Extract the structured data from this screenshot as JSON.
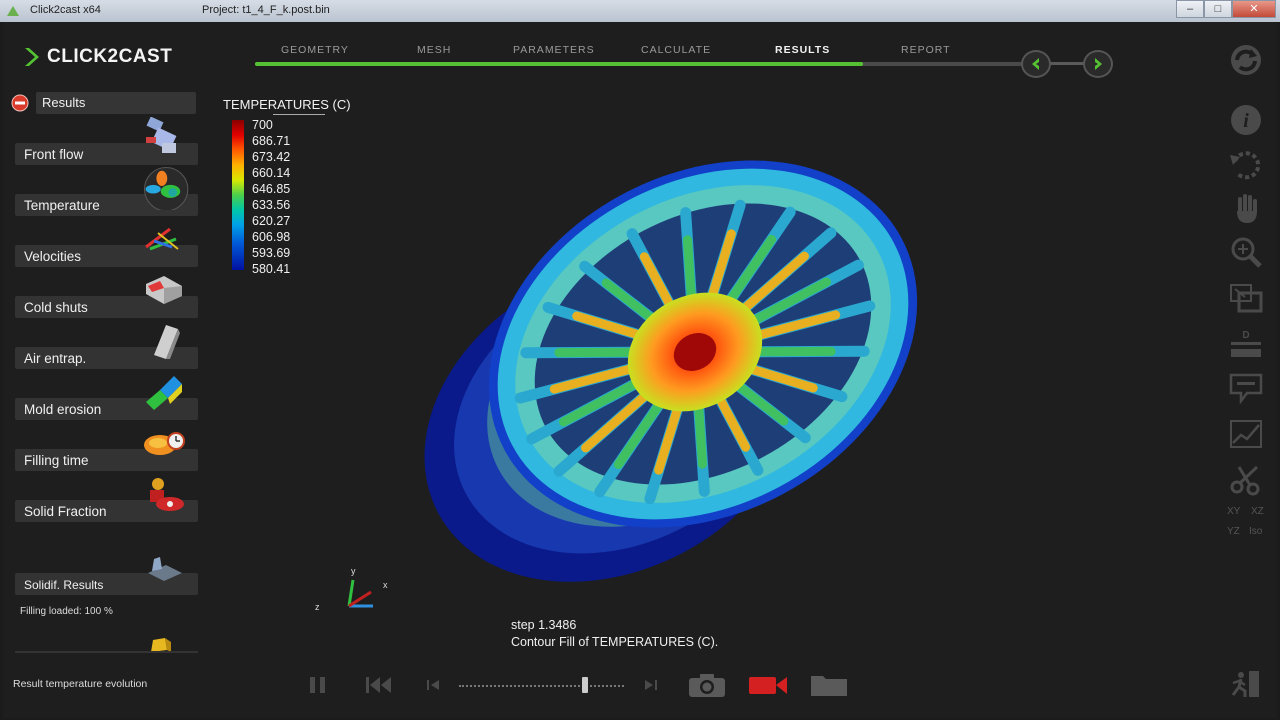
{
  "os": {
    "app_title": "Click2cast x64",
    "project_title": "Project: t1_4_F_k.post.bin"
  },
  "logo": {
    "text": "CLICK2CAST"
  },
  "workflow": {
    "tabs": [
      {
        "label": "GEOMETRY"
      },
      {
        "label": "MESH"
      },
      {
        "label": "PARAMETERS"
      },
      {
        "label": "CALCULATE"
      },
      {
        "label": "RESULTS"
      },
      {
        "label": "REPORT"
      }
    ],
    "active": "RESULTS",
    "progress_fraction": 0.78
  },
  "sidebar": {
    "header": "Results",
    "items": [
      {
        "label": "Front flow",
        "icon": "front-flow-icon"
      },
      {
        "label": "Temperature",
        "icon": "temperature-icon"
      },
      {
        "label": "Velocities",
        "icon": "velocities-icon"
      },
      {
        "label": "Cold shuts",
        "icon": "cold-shuts-icon"
      },
      {
        "label": "Air entrap.",
        "icon": "air-entrapment-icon"
      },
      {
        "label": "Mold erosion",
        "icon": "mold-erosion-icon"
      },
      {
        "label": "Filling time",
        "icon": "filling-time-icon"
      },
      {
        "label": "Solid Fraction",
        "icon": "solid-fraction-icon"
      },
      {
        "label": "Solidif. Results",
        "icon": "solidification-results-icon"
      }
    ],
    "filling_loaded": "Filling loaded: 100 %",
    "status": "Result temperature evolution"
  },
  "legend": {
    "title": "TEMPERATURES (C)",
    "values": [
      "700",
      "686.71",
      "673.42",
      "660.14",
      "646.85",
      "633.56",
      "620.27",
      "606.98",
      "593.69",
      "580.41"
    ]
  },
  "viewport": {
    "step": "step 1.3486",
    "description": "Contour Fill of TEMPERATURES (C)."
  },
  "axes": {
    "x": "x",
    "y": "y",
    "z": "z"
  },
  "right_toolbar": {
    "plane_labels": [
      "XY",
      "XZ",
      "YZ",
      "Iso"
    ],
    "icons": [
      "refresh-icon",
      "info-icon",
      "rotate-icon",
      "pan-hand-icon",
      "zoom-icon",
      "zoom-window-icon",
      "distance-icon",
      "label-icon",
      "graph-icon",
      "cut-icon",
      "exit-icon"
    ]
  },
  "colors": {
    "accent_green": "#55c234",
    "record_red": "#d42020",
    "background": "#1e1e1e"
  }
}
